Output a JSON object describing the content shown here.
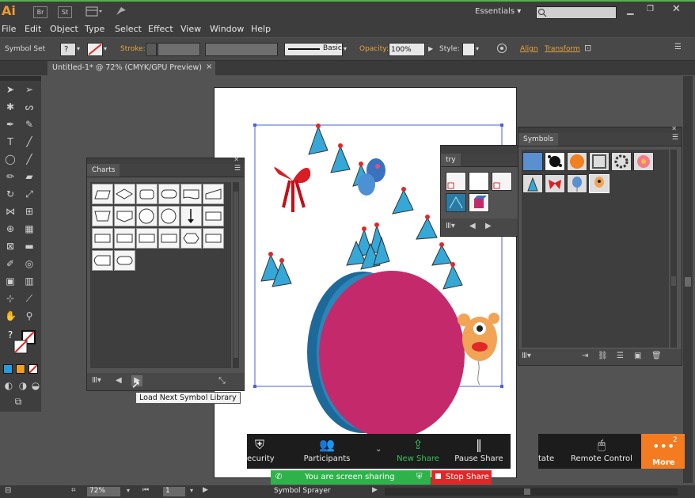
{
  "app": {
    "logo": "Ai",
    "workspace": "Essentials",
    "bridge_btn": "Br",
    "stock_btn": "St"
  },
  "menu": [
    "File",
    "Edit",
    "Object",
    "Type",
    "Select",
    "Effect",
    "View",
    "Window",
    "Help"
  ],
  "control": {
    "selection_label": "Symbol Set",
    "stroke_label": "Stroke:",
    "brush_label": "Basic",
    "opacity_label": "Opacity:",
    "opacity_value": "100%",
    "style_label": "Style:",
    "align_label": "Align",
    "transform_label": "Transform"
  },
  "document_tab": "Untitled-1* @ 72% (CMYK/GPU Preview)",
  "charts_panel": {
    "title": "Charts",
    "cell_count": 20
  },
  "try_panel": {
    "title": "try"
  },
  "symbols_panel": {
    "title": "Symbols"
  },
  "tooltip": "Load Next Symbol Library",
  "zoom_meeting": {
    "security": "ecurity",
    "participants": "Participants",
    "new_share": "New Share",
    "pause_share": "Pause Share",
    "state": "tate",
    "remote_control": "Remote Control",
    "more": "More",
    "more_badge": "2"
  },
  "sharing_banner": {
    "status": "You are screen sharing",
    "stop": "Stop Share"
  },
  "statusbar": {
    "zoom": "72%",
    "page": "1",
    "tool": "Symbol Sprayer"
  },
  "colors": {
    "accent_orange": "#e8a23a",
    "zoom_orange": "#f47b20",
    "share_green": "#2eb34a",
    "stop_red": "#e02828",
    "balloon_pink": "#c42a6b"
  }
}
